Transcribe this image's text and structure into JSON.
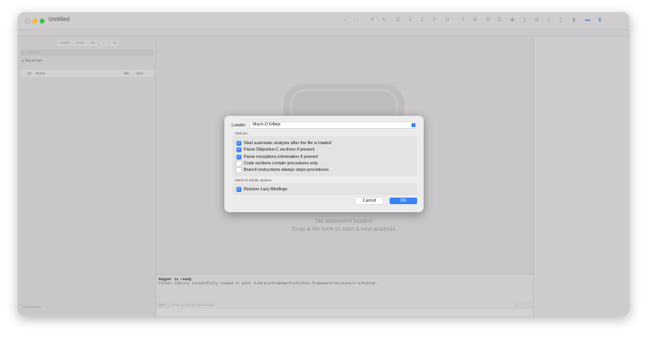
{
  "window": {
    "title": "Untitled"
  },
  "toolbar": {
    "items": [
      "‹",
      "›",
      "↺",
      "↻",
      "D",
      "A",
      "C",
      "P",
      "U",
      "≡",
      "⊞",
      "⊟",
      "☰",
      "◉",
      "▯",
      "⊟",
      "▯",
      "▯",
      "▮",
      "▬",
      "▮"
    ]
  },
  "sidebar": {
    "segments": [
      "Labels",
      "Procs",
      "Str",
      "≡",
      "⊕"
    ],
    "search_placeholder": "Search",
    "tag_scope": "Tag Scope",
    "columns": {
      "idx": "Idx",
      "name": "Name",
      "blocks": "Blo...",
      "size": "Size"
    },
    "footer": "0 procedures"
  },
  "main": {
    "empty_line1": "No document loaded.",
    "empty_line2": "Drop a file here to start a new analysis."
  },
  "console": {
    "line1": "Hopper is ready",
    "line2": "Python library successfully loaded at path /Library/Frameworks/Python.framework/Versions/3.6/Python.",
    "prompt": ">>>",
    "input_placeholder": "Enter a Python Command"
  },
  "dialog": {
    "loader_label": "Loader:",
    "loader_value": "Mach-O 64bits",
    "options_label": "Options",
    "options": [
      {
        "label": "Start automatic analysis after the file is loaded",
        "checked": true
      },
      {
        "label": "Parse Objective-C sections if present",
        "checked": true
      },
      {
        "label": "Parse exceptions information if present",
        "checked": true
      },
      {
        "label": "Code sections contain procedures only",
        "checked": false
      },
      {
        "label": "Branch instructions always stops procedures",
        "checked": false
      }
    ],
    "macho_label": "Mach-O 64bits options",
    "macho_options": [
      {
        "label": "Resolve Lazy Bindings",
        "checked": true
      }
    ],
    "cancel": "Cancel",
    "ok": "OK"
  }
}
